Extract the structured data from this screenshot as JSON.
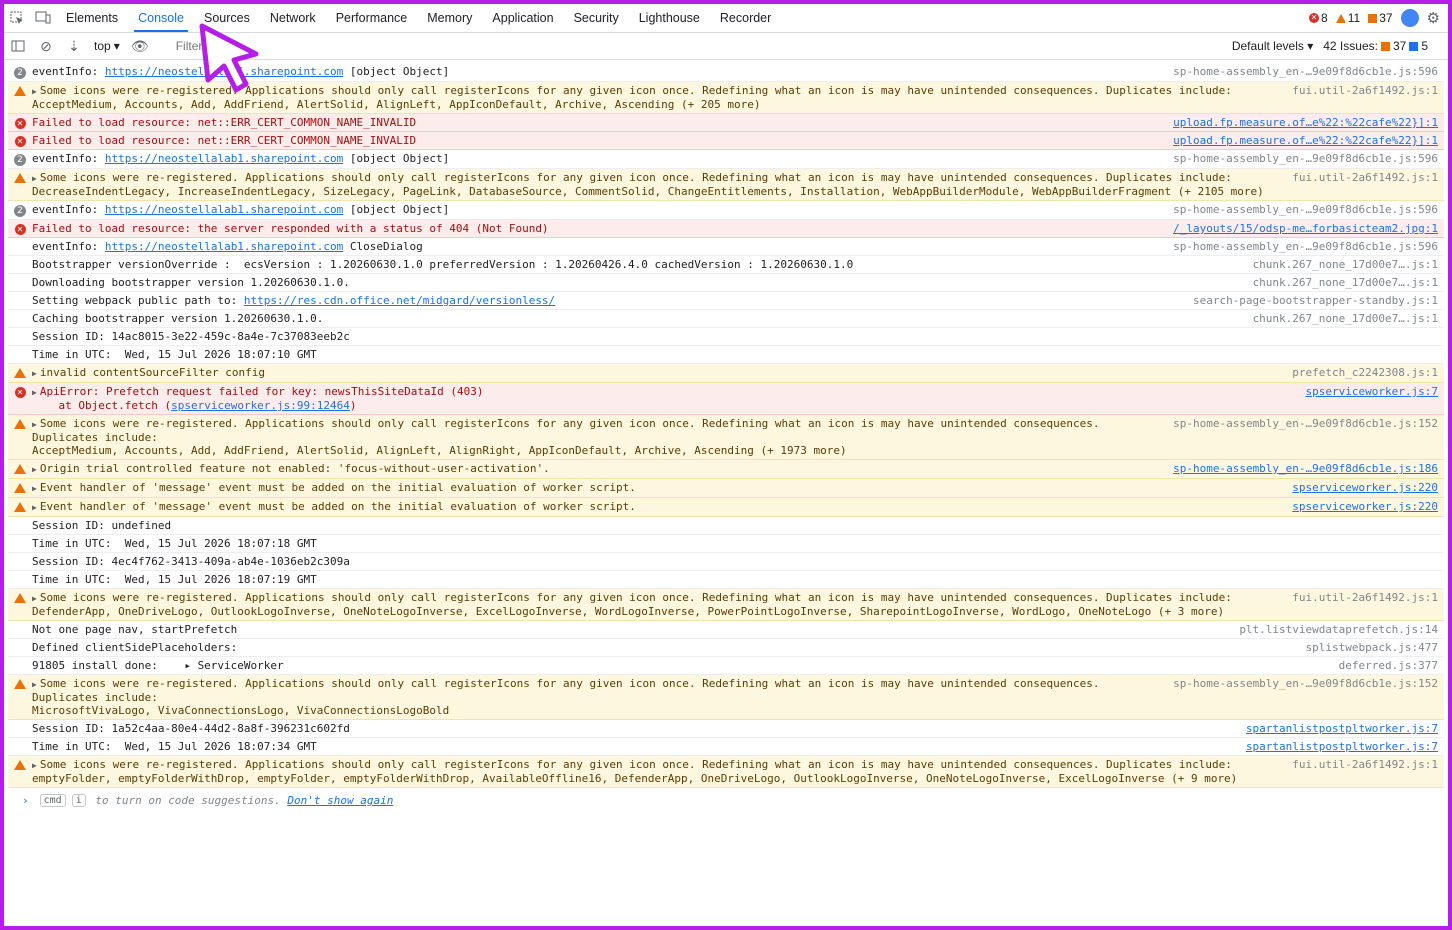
{
  "tabs": [
    "Elements",
    "Console",
    "Sources",
    "Network",
    "Performance",
    "Memory",
    "Application",
    "Security",
    "Lighthouse",
    "Recorder"
  ],
  "active_tab": "Console",
  "counts": {
    "errors": "8",
    "warnings": "11",
    "issues": "37"
  },
  "filterbar": {
    "context": "top",
    "filter_placeholder": "Filter",
    "levels": "Default levels",
    "issues_label": "42 Issues:",
    "issues_count": "37",
    "info_count": "5"
  },
  "rows": [
    {
      "type": "count",
      "count": "2",
      "text": "eventInfo: ",
      "link": "https://neostellalab1.sharepoint.com",
      "rest": " [object Object]",
      "src": "sp-home-assembly_en-…9e09f8d6cb1e.js:596"
    },
    {
      "type": "warn",
      "expand": true,
      "text": "Some icons were re-registered. Applications should only call registerIcons for any given icon once. Redefining what an icon is may have unintended consequences. Duplicates include:\nAcceptMedium, Accounts, Add, AddFriend, AlertSolid, AlignLeft, AppIconDefault, Archive, Ascending (+ 205 more)",
      "src": "fui.util-2a6f1492.js:1"
    },
    {
      "type": "err",
      "text": "Failed to load resource: net::ERR_CERT_COMMON_NAME_INVALID",
      "src": "upload.fp.measure.of…e%22:%22cafe%22}]:1",
      "srclink": true
    },
    {
      "type": "err",
      "text": "Failed to load resource: net::ERR_CERT_COMMON_NAME_INVALID",
      "src": "upload.fp.measure.of…e%22:%22cafe%22}]:1",
      "srclink": true
    },
    {
      "type": "count",
      "count": "2",
      "text": "eventInfo: ",
      "link": "https://neostellalab1.sharepoint.com",
      "rest": " [object Object]",
      "src": "sp-home-assembly_en-…9e09f8d6cb1e.js:596"
    },
    {
      "type": "warn",
      "expand": true,
      "text": "Some icons were re-registered. Applications should only call registerIcons for any given icon once. Redefining what an icon is may have unintended consequences. Duplicates include:\nDecreaseIndentLegacy, IncreaseIndentLegacy, SizeLegacy, PageLink, DatabaseSource, CommentSolid, ChangeEntitlements, Installation, WebAppBuilderModule, WebAppBuilderFragment (+ 2105 more)",
      "src": "fui.util-2a6f1492.js:1"
    },
    {
      "type": "count",
      "count": "2",
      "text": "eventInfo: ",
      "link": "https://neostellalab1.sharepoint.com",
      "rest": " [object Object]",
      "src": "sp-home-assembly_en-…9e09f8d6cb1e.js:596"
    },
    {
      "type": "err",
      "text": "Failed to load resource: the server responded with a status of 404 (Not Found)",
      "src": "/_layouts/15/odsp-me…forbasicteam2.jpg:1",
      "srclink": true
    },
    {
      "type": "log",
      "text": "eventInfo: ",
      "link": "https://neostellalab1.sharepoint.com",
      "rest": " CloseDialog",
      "src": "sp-home-assembly_en-…9e09f8d6cb1e.js:596"
    },
    {
      "type": "log",
      "text": "Bootstrapper versionOverride :  ecsVersion : 1.20260630.1.0 preferredVersion : 1.20260426.4.0 cachedVersion : 1.20260630.1.0",
      "src": "chunk.267_none_17d00e7….js:1"
    },
    {
      "type": "log",
      "text": "Downloading bootstrapper version 1.20260630.1.0.",
      "src": "chunk.267_none_17d00e7….js:1"
    },
    {
      "type": "log",
      "text": "Setting webpack public path to: ",
      "link": "https://res.cdn.office.net/midgard/versionless/",
      "rest": "",
      "src": "search-page-bootstrapper-standby.js:1"
    },
    {
      "type": "log",
      "text": "Caching bootstrapper version 1.20260630.1.0.",
      "src": "chunk.267_none_17d00e7….js:1"
    },
    {
      "type": "log",
      "text": "Session ID: 14ac8015-3e22-459c-8a4e-7c37083eeb2c",
      "src": ""
    },
    {
      "type": "log",
      "text": "Time in UTC:  Wed, 15 Jul 2026 18:07:10 GMT",
      "src": ""
    },
    {
      "type": "warn",
      "expand": true,
      "text": "invalid contentSourceFilter config",
      "src": "prefetch_c2242308.js:1"
    },
    {
      "type": "err",
      "expand": true,
      "text": "ApiError: Prefetch request failed for key: newsThisSiteDataId (403)\n    at Object.fetch (",
      "link": "spserviceworker.js:99:12464",
      "rest": ")",
      "src": "spserviceworker.js:7",
      "srclink": true
    },
    {
      "type": "warn",
      "expand": true,
      "text": "Some icons were re-registered. Applications should only call registerIcons for any given icon once. Redefining what an icon is may have unintended consequences.\nDuplicates include:\nAcceptMedium, Accounts, Add, AddFriend, AlertSolid, AlignLeft, AlignRight, AppIconDefault, Archive, Ascending (+ 1973 more)",
      "src": "sp-home-assembly_en-…9e09f8d6cb1e.js:152"
    },
    {
      "type": "warn",
      "expand": true,
      "text": "Origin trial controlled feature not enabled: 'focus-without-user-activation'.",
      "src": "sp-home-assembly_en-…9e09f8d6cb1e.js:186",
      "srclink": true
    },
    {
      "type": "warn",
      "expand": true,
      "text": "Event handler of 'message' event must be added on the initial evaluation of worker script.",
      "src": "spserviceworker.js:220",
      "srclink": true
    },
    {
      "type": "warn",
      "expand": true,
      "text": "Event handler of 'message' event must be added on the initial evaluation of worker script.",
      "src": "spserviceworker.js:220",
      "srclink": true
    },
    {
      "type": "log",
      "text": "Session ID: undefined",
      "src": ""
    },
    {
      "type": "log",
      "text": "Time in UTC:  Wed, 15 Jul 2026 18:07:18 GMT",
      "src": ""
    },
    {
      "type": "log",
      "text": "Session ID: 4ec4f762-3413-409a-ab4e-1036eb2c309a",
      "src": ""
    },
    {
      "type": "log",
      "text": "Time in UTC:  Wed, 15 Jul 2026 18:07:19 GMT",
      "src": ""
    },
    {
      "type": "warn",
      "expand": true,
      "text": "Some icons were re-registered. Applications should only call registerIcons for any given icon once. Redefining what an icon is may have unintended consequences. Duplicates include:\nDefenderApp, OneDriveLogo, OutlookLogoInverse, OneNoteLogoInverse, ExcelLogoInverse, WordLogoInverse, PowerPointLogoInverse, SharepointLogoInverse, WordLogo, OneNoteLogo (+ 3 more)",
      "src": "fui.util-2a6f1492.js:1"
    },
    {
      "type": "log",
      "text": "Not one page nav, startPrefetch",
      "src": "plt.listviewdataprefetch.js:14"
    },
    {
      "type": "log",
      "text": "Defined clientSidePlaceholders:",
      "src": "splistwebpack.js:477"
    },
    {
      "type": "log",
      "text": "91805 install done:    ▸ ServiceWorker",
      "src": "deferred.js:377"
    },
    {
      "type": "warn",
      "expand": true,
      "text": "Some icons were re-registered. Applications should only call registerIcons for any given icon once. Redefining what an icon is may have unintended consequences.\nDuplicates include:\nMicrosoftVivaLogo, VivaConnectionsLogo, VivaConnectionsLogoBold",
      "src": "sp-home-assembly_en-…9e09f8d6cb1e.js:152"
    },
    {
      "type": "log",
      "text": "Session ID: 1a52c4aa-80e4-44d2-8a8f-396231c602fd",
      "src": "spartanlistpostpltworker.js:7",
      "srclink": true
    },
    {
      "type": "log",
      "text": "Time in UTC:  Wed, 15 Jul 2026 18:07:34 GMT",
      "src": "spartanlistpostpltworker.js:7",
      "srclink": true
    },
    {
      "type": "warn",
      "expand": true,
      "text": "Some icons were re-registered. Applications should only call registerIcons for any given icon once. Redefining what an icon is may have unintended consequences. Duplicates include:\nemptyFolder, emptyFolderWithDrop, emptyFolder, emptyFolderWithDrop, AvailableOffline16, DefenderApp, OneDriveLogo, OutlookLogoInverse, OneNoteLogoInverse, ExcelLogoInverse (+ 9 more)",
      "src": "fui.util-2a6f1492.js:1"
    }
  ],
  "prompt": {
    "kbd1": "cmd",
    "kbd2": "i",
    "text": " to turn on code suggestions. ",
    "link": "Don't show again"
  },
  "colors": {
    "accent": "#1a73e8",
    "frame": "#b41ee6",
    "warn_bg": "#fef7e0",
    "err_bg": "#fdecec"
  }
}
